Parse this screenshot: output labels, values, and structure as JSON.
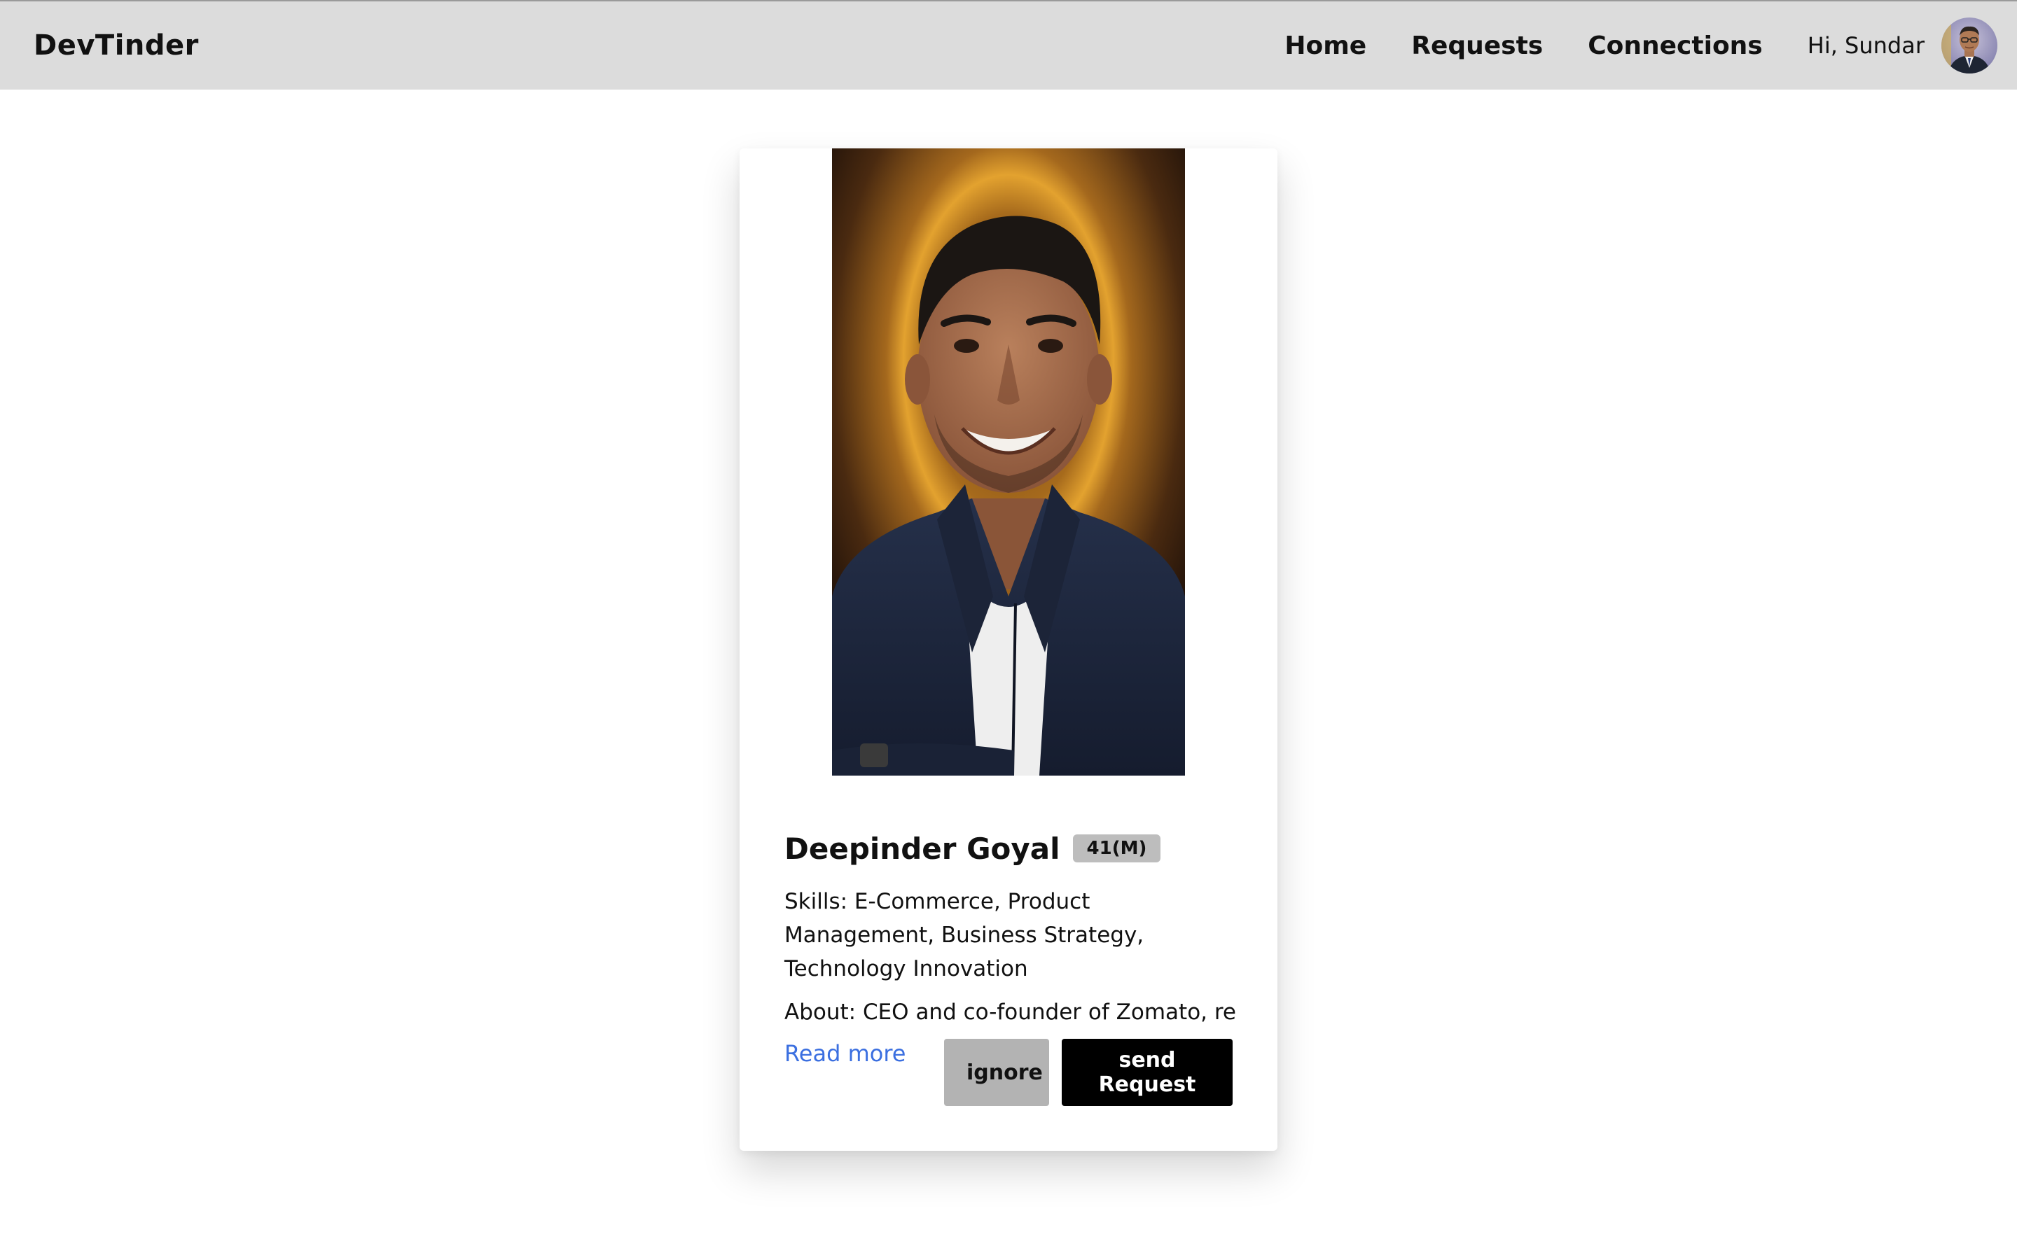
{
  "navbar": {
    "brand": "DevTinder",
    "links": [
      "Home",
      "Requests",
      "Connections"
    ],
    "greeting": "Hi, Sundar",
    "avatar_icon": "user-avatar-photo"
  },
  "card": {
    "photo_icon": "profile-photo",
    "name": "Deepinder Goyal",
    "age_gender": "41(M)",
    "skills": "Skills: E-Commerce, Product Management, Business Strategy, Technology Innovation",
    "about": "About: CEO and co-founder of Zomato, re...",
    "read_more": "Read more",
    "ignore_label": "ignore",
    "send_label": "send Request"
  },
  "colors": {
    "navbar_bg": "#dcdcdc",
    "link_blue": "#3b6fe0",
    "badge_bg": "#bdbdbd",
    "ignore_bg": "#b3b3b3",
    "send_bg": "#000000"
  }
}
